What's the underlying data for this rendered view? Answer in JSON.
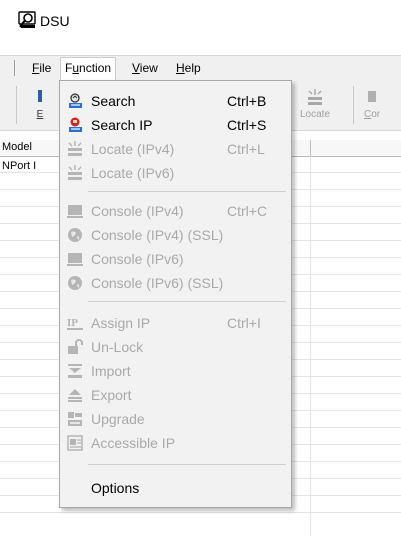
{
  "window": {
    "title": "DSU"
  },
  "menubar": {
    "items": [
      {
        "label": "File",
        "accel": "F",
        "rest": "ile"
      },
      {
        "label": "Function",
        "pre": "F",
        "accel": "u",
        "rest": "nction"
      },
      {
        "label": "View",
        "accel": "V",
        "rest": "iew"
      },
      {
        "label": "Help",
        "accel": "H",
        "rest": "elp"
      }
    ]
  },
  "toolbar": {
    "buttons": [
      {
        "label_accel": "E",
        "label": "E"
      },
      {
        "label": "Locate"
      },
      {
        "label_accel": "C",
        "label_rest": "or",
        "label": "Cor"
      }
    ]
  },
  "list": {
    "columns": [
      "Model"
    ],
    "rows": [
      "NPort I"
    ]
  },
  "function_menu": {
    "items": [
      {
        "label": "Search",
        "shortcut": "Ctrl+B",
        "enabled": true,
        "icon": "search-computer-icon"
      },
      {
        "label": "Search IP",
        "shortcut": "Ctrl+S",
        "enabled": true,
        "icon": "search-ip-icon"
      },
      {
        "label": "Locate (IPv4)",
        "shortcut": "Ctrl+L",
        "enabled": false,
        "icon": "locate-icon"
      },
      {
        "label": "Locate (IPv6)",
        "shortcut": "",
        "enabled": false,
        "icon": "locate-icon"
      },
      {
        "label": "Console (IPv4)",
        "shortcut": "Ctrl+C",
        "enabled": false,
        "icon": "console-icon"
      },
      {
        "label": "Console (IPv4) (SSL)",
        "shortcut": "",
        "enabled": false,
        "icon": "globe-icon"
      },
      {
        "label": "Console (IPv6)",
        "shortcut": "",
        "enabled": false,
        "icon": "console-icon"
      },
      {
        "label": "Console (IPv6) (SSL)",
        "shortcut": "",
        "enabled": false,
        "icon": "globe-icon"
      },
      {
        "label": "Assign IP",
        "shortcut": "Ctrl+I",
        "enabled": false,
        "icon": "assign-ip-icon"
      },
      {
        "label": "Un-Lock",
        "shortcut": "",
        "enabled": false,
        "icon": "unlock-icon"
      },
      {
        "label": "Import",
        "shortcut": "",
        "enabled": false,
        "icon": "import-icon"
      },
      {
        "label": "Export",
        "shortcut": "",
        "enabled": false,
        "icon": "export-icon"
      },
      {
        "label": "Upgrade",
        "shortcut": "",
        "enabled": false,
        "icon": "upgrade-icon"
      },
      {
        "label": "Accessible IP",
        "shortcut": "",
        "enabled": false,
        "icon": "accessible-ip-icon"
      },
      {
        "label": "Options",
        "shortcut": "",
        "enabled": true,
        "icon": ""
      }
    ]
  }
}
